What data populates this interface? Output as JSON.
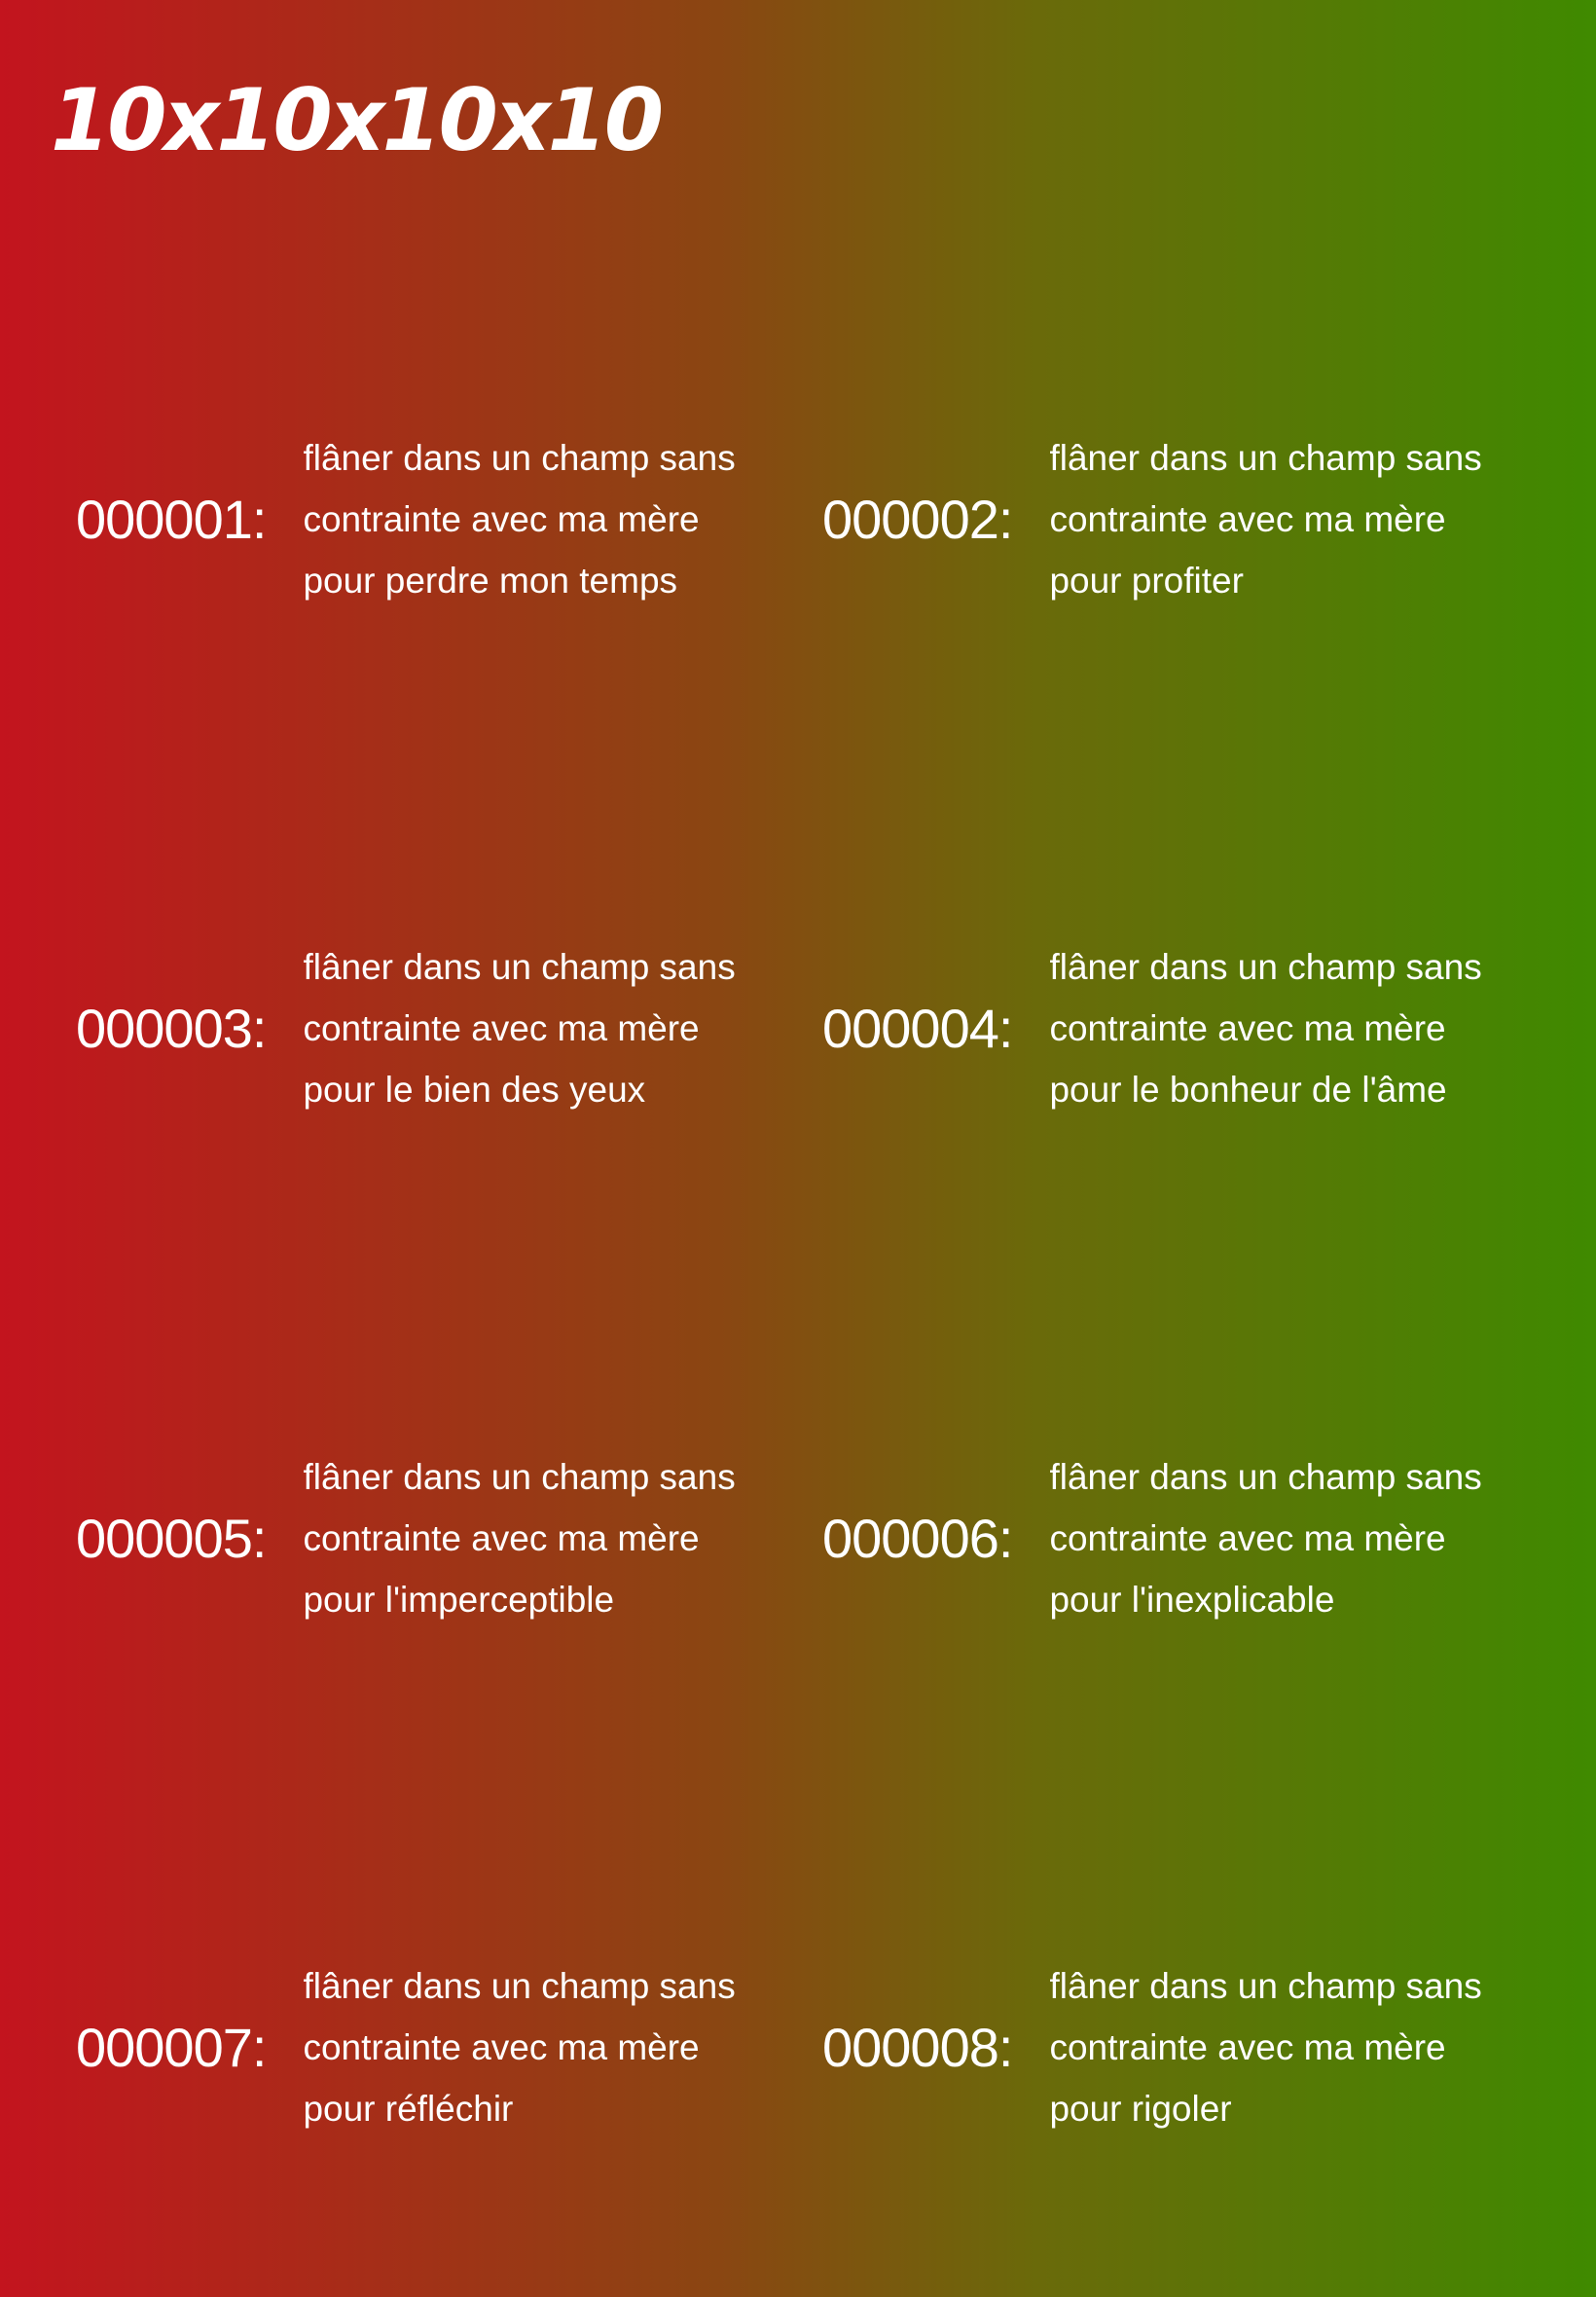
{
  "title": "10x10x10x10",
  "entries": [
    {
      "number": "000001:",
      "text": "flâner dans un champ sans contrainte avec ma mère pour perdre mon temps"
    },
    {
      "number": "000002:",
      "text": "flâner dans un champ sans contrainte avec ma mère pour profiter"
    },
    {
      "number": "000003:",
      "text": "flâner dans un champ sans contrainte avec ma mère pour le bien des yeux"
    },
    {
      "number": "000004:",
      "text": "flâner dans un champ sans contrainte avec ma mère pour le bonheur de l'âme"
    },
    {
      "number": "000005:",
      "text": "flâner dans un champ sans contrainte avec ma mère pour l'imperceptible"
    },
    {
      "number": "000006:",
      "text": "flâner dans un champ sans contrainte avec ma mère pour l'inexplicable"
    },
    {
      "number": "000007:",
      "text": "flâner dans un champ sans contrainte avec ma mère pour réfléchir"
    },
    {
      "number": "000008:",
      "text": "flâner dans un champ sans contrainte avec ma mère pour rigoler"
    }
  ],
  "colors": {
    "gradient_left": "#c3141e",
    "gradient_right": "#3f8a00",
    "text": "#ffffff"
  }
}
